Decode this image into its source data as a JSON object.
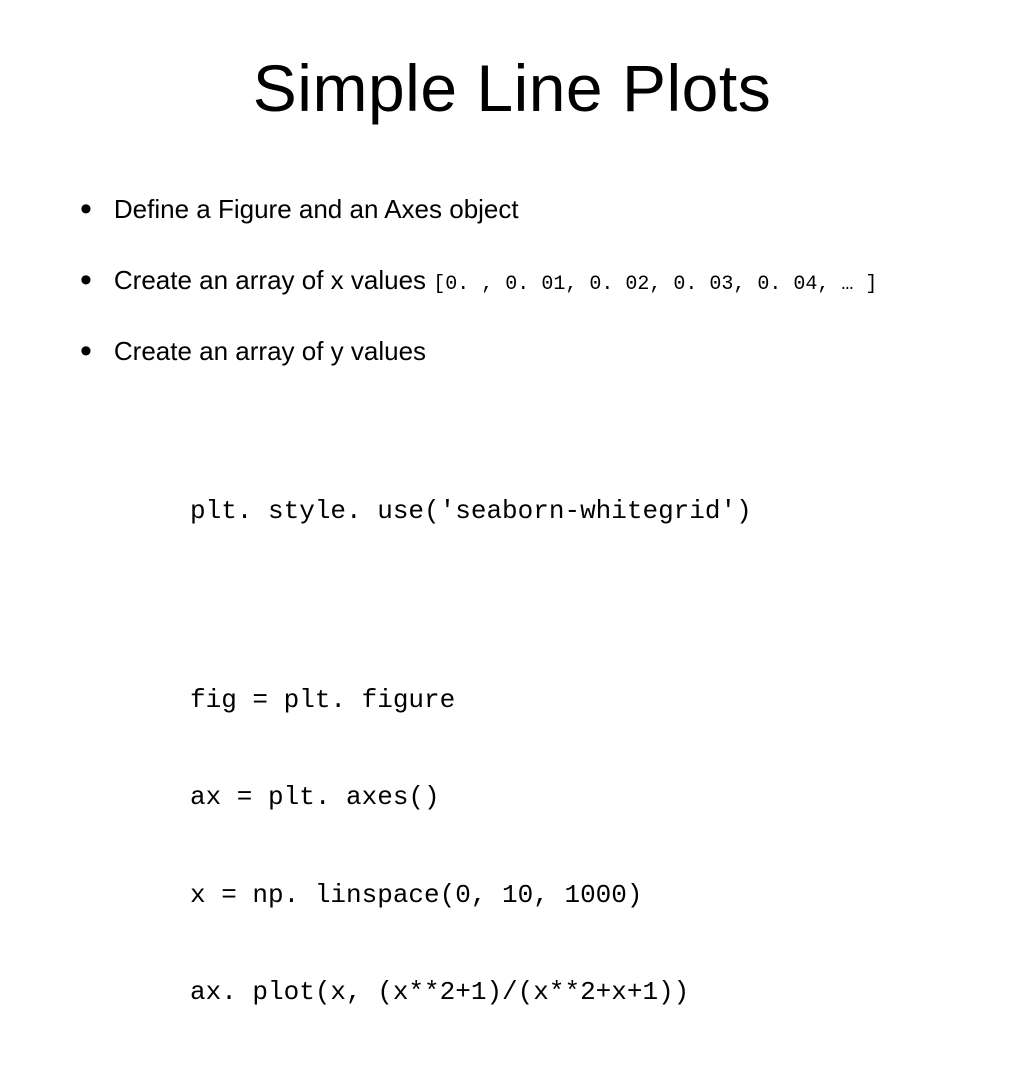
{
  "title": "Simple Line Plots",
  "bullets": [
    {
      "text": "Define a Figure and an Axes object",
      "code": ""
    },
    {
      "text": "Create an array of x values ",
      "code": "[0. , 0. 01, 0. 02, 0. 03, 0. 04, … ]"
    },
    {
      "text": "Create an array of y values",
      "code": ""
    }
  ],
  "code_lines": {
    "l1": "plt. style. use('seaborn-whitegrid')",
    "l2": "fig = plt. figure",
    "l3": "ax = plt. axes()",
    "l4": "x = np. linspace(0, 10, 1000)",
    "l5": "ax. plot(x, (x**2+1)/(x**2+x+1))"
  }
}
